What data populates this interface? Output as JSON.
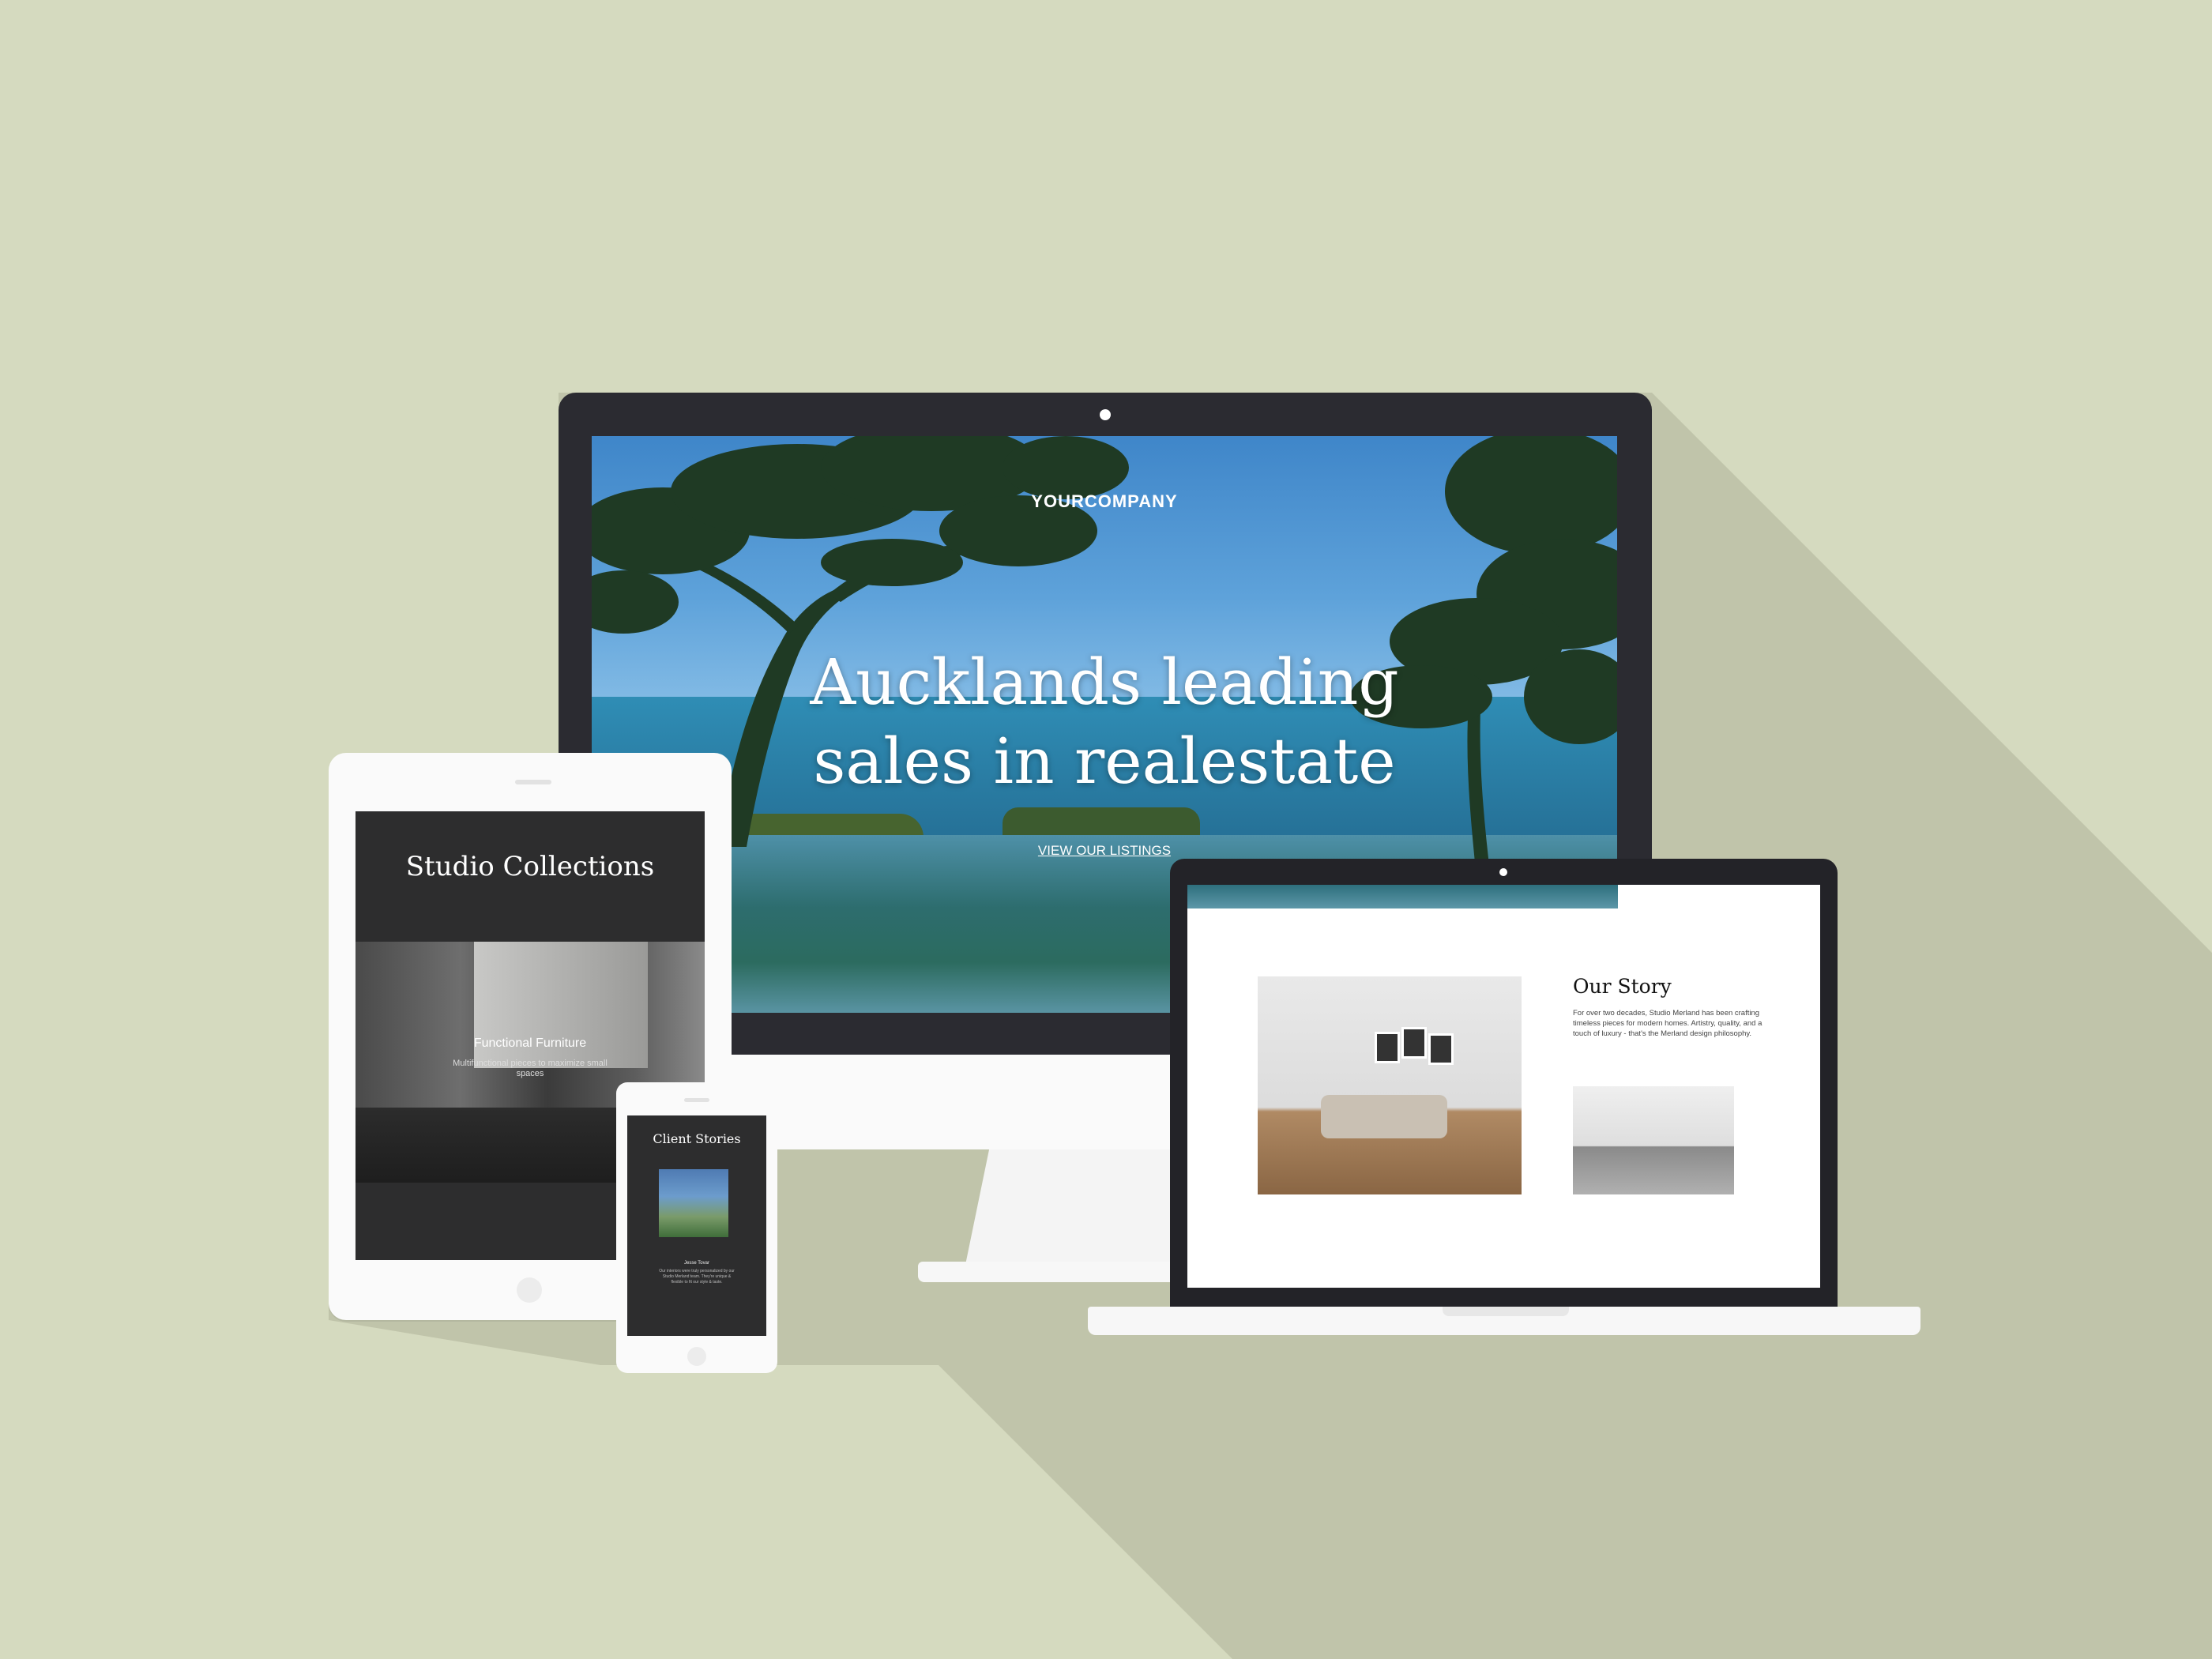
{
  "background": {
    "color": "#d5dabf",
    "shadow_color": "#c0c4aa"
  },
  "desktop": {
    "brand": "YOURCOMPANY",
    "headline_line1": "Aucklands leading",
    "headline_line2": "sales in realestate",
    "cta_link": "VIEW OUR LISTINGS"
  },
  "tablet": {
    "title": "Studio Collections",
    "feature_title": "Functional Furniture",
    "feature_desc": "Multifunctional pieces to maximize small spaces"
  },
  "phone": {
    "title": "Client Stories",
    "name": "Jesse Tovar",
    "quote": "Our interiors were truly personalized by our Studio Merland team. They're unique & flexible to fit our style & taste."
  },
  "laptop": {
    "heading": "Our Story",
    "paragraph": "For over two decades, Studio Merland has been crafting timeless pieces for modern homes. Artistry, quality, and a touch of luxury - that's the Merland design philosophy."
  }
}
